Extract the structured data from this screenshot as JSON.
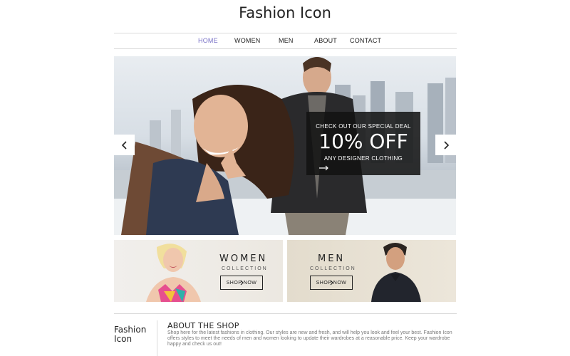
{
  "site": {
    "title": "Fashion Icon"
  },
  "nav": {
    "items": [
      {
        "label": "HOME",
        "active": true
      },
      {
        "label": "WOMEN",
        "active": false
      },
      {
        "label": "MEN",
        "active": false
      },
      {
        "label": "ABOUT",
        "active": false
      },
      {
        "label": "CONTACT",
        "active": false
      }
    ]
  },
  "hero": {
    "deal_line1": "CHECK OUT OUR SPECIAL DEAL",
    "deal_line2": "10% OFF",
    "deal_line3": "ANY DESIGNER CLOTHING",
    "prev_icon": "chevron-left-icon",
    "next_icon": "chevron-right-icon",
    "arrow_icon": "arrow-right-icon"
  },
  "promos": {
    "women": {
      "title": "WOMEN",
      "subtitle": "COLLECTION",
      "button": "SHOP NOW"
    },
    "men": {
      "title": "MEN",
      "subtitle": "COLLECTION",
      "button": "SHOP NOW"
    }
  },
  "footer": {
    "logo_line1": "Fashion",
    "logo_line2": "Icon",
    "about_title": "ABOUT THE SHOP",
    "about_text": "Shop here for the latest fashions in clothing.  Our styles are new and fresh, and will help you look and feel your best. Fashion Icon offers styles to meet the needs of men and women looking to update their wardrobes at a reasonable price.  Keep your wardrobe happy and check us out!"
  },
  "colors": {
    "accent": "#7a73c7",
    "text": "#222222",
    "overlay": "#121212"
  }
}
